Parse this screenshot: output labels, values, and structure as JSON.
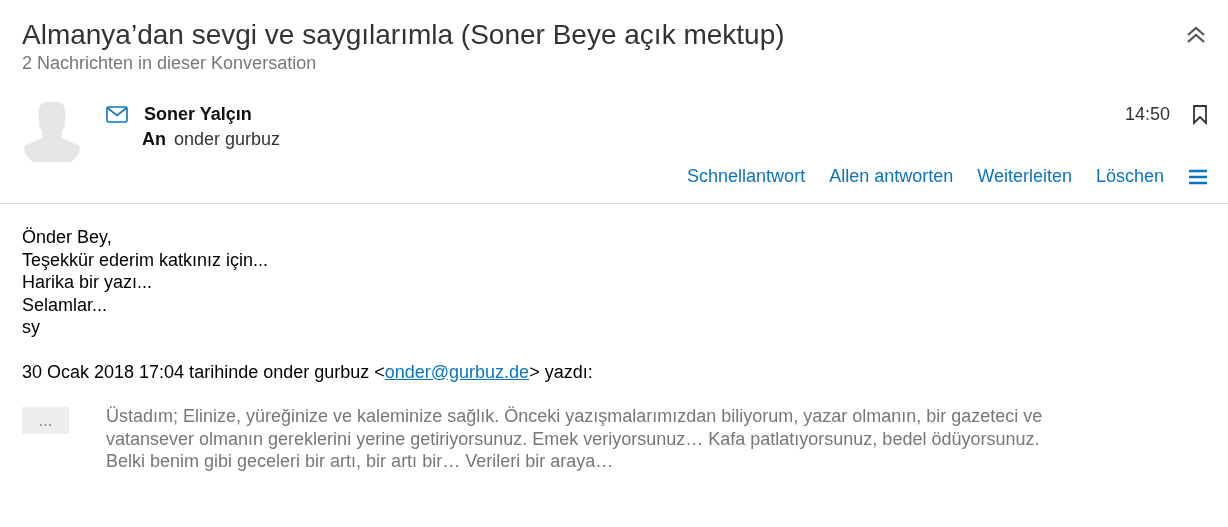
{
  "conversation": {
    "title": "Almanya’dan sevgi ve saygılarımla (Soner Beye açık mektup)",
    "subtitle": "2 Nachrichten in dieser Konversation"
  },
  "message": {
    "sender": "Soner Yalçın",
    "to_label": "An",
    "to": "onder gurbuz",
    "time": "14:50",
    "unread": true,
    "actions": [
      "Schnellantwort",
      "Allen antworten",
      "Weiterleiten",
      "Löschen"
    ],
    "body": [
      "Önder Bey,",
      "Teşekkür ederim katkınız için...",
      "Harika bir yazı...",
      "Selamlar...",
      "sy"
    ],
    "quote_header": {
      "before": "30 Ocak 2018 17:04 tarihinde onder gurbuz <",
      "email": "onder@gurbuz.de",
      "after": "> yazdı:"
    },
    "expand_button": "...",
    "quote": "Üstadım; Elinize, yüreğinize ve kaleminize sağlık. Önceki yazışmalarımızdan biliyorum, yazar olmanın, bir gazeteci ve vatansever olmanın gereklerini yerine getiriyorsunuz. Emek veriyorsunuz… Kafa patlatıyorsunuz, bedel ödüyorsunuz. Belki benim gibi geceleri bir artı, bir artı bir… Verileri bir araya…"
  }
}
